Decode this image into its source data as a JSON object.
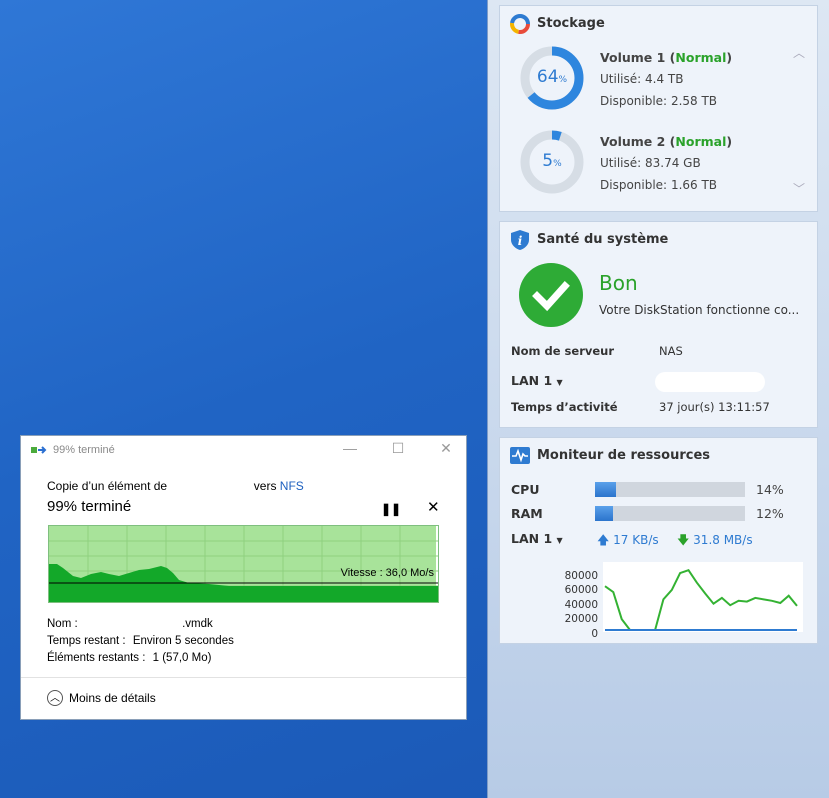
{
  "dialog": {
    "title": "99% terminé",
    "copy_prefix": "Copie d’un élément de",
    "copy_to": "vers",
    "destination": "NFS",
    "progress_text": "99% terminé",
    "speed_label": "Vitesse : 36,0 Mo/s",
    "name_label": "Nom :",
    "name_value": ".vmdk",
    "remaining_time_label": "Temps restant :",
    "remaining_time_value": "Environ 5 secondes",
    "remaining_items_label": "Éléments restants :",
    "remaining_items_value": "1 (57,0 Mo)",
    "less_details": "Moins de détails",
    "progress_fraction": 0.99
  },
  "storage": {
    "title": "Stockage",
    "volumes": [
      {
        "name": "Volume 1",
        "status": "Normal",
        "percent": 64,
        "used_label": "Utilisé:",
        "used": "4.4 TB",
        "free_label": "Disponible:",
        "free": "2.58 TB"
      },
      {
        "name": "Volume 2",
        "status": "Normal",
        "percent": 5,
        "used_label": "Utilisé:",
        "used": "83.74 GB",
        "free_label": "Disponible:",
        "free": "1.66 TB"
      }
    ]
  },
  "health": {
    "title": "Santé du système",
    "status": "Bon",
    "description": "Votre DiskStation fonctionne co...",
    "server_label": "Nom de serveur",
    "server_value": "NAS",
    "lan_label": "LAN 1",
    "uptime_label": "Temps d’activité",
    "uptime_value": "37 jour(s) 13:11:57"
  },
  "monitor": {
    "title": "Moniteur de ressources",
    "cpu_label": "CPU",
    "cpu_percent": 14,
    "cpu_text": "14%",
    "ram_label": "RAM",
    "ram_percent": 12,
    "ram_text": "12%",
    "lan_label": "LAN 1",
    "upload": "17 KB/s",
    "download": "31.8 MB/s",
    "y_ticks": [
      "80000",
      "60000",
      "40000",
      "20000",
      "0"
    ]
  },
  "chart_data": {
    "type": "line",
    "ylim": [
      0,
      85000
    ],
    "y_ticks": [
      80000,
      60000,
      40000,
      20000,
      0
    ],
    "series": [
      {
        "values": [
          60000,
          52000,
          15000,
          -2000,
          -2000,
          -2000,
          -2000,
          42000,
          55000,
          78000,
          82000,
          65000,
          50000,
          36000,
          44000,
          34000,
          40000,
          39000,
          44000,
          42000,
          40000,
          37000,
          47000,
          33000
        ]
      },
      {
        "values": [
          0,
          0,
          0,
          0,
          0,
          0,
          0,
          0,
          0,
          0,
          0,
          0,
          0,
          0,
          0,
          0,
          0,
          0,
          0,
          0,
          0,
          0,
          0,
          0
        ]
      }
    ]
  },
  "colors": {
    "accent": "#2e7bd1",
    "ok": "#2aa22a",
    "graph_fill": "#13a829",
    "graph_bg": "#a8e39a"
  }
}
